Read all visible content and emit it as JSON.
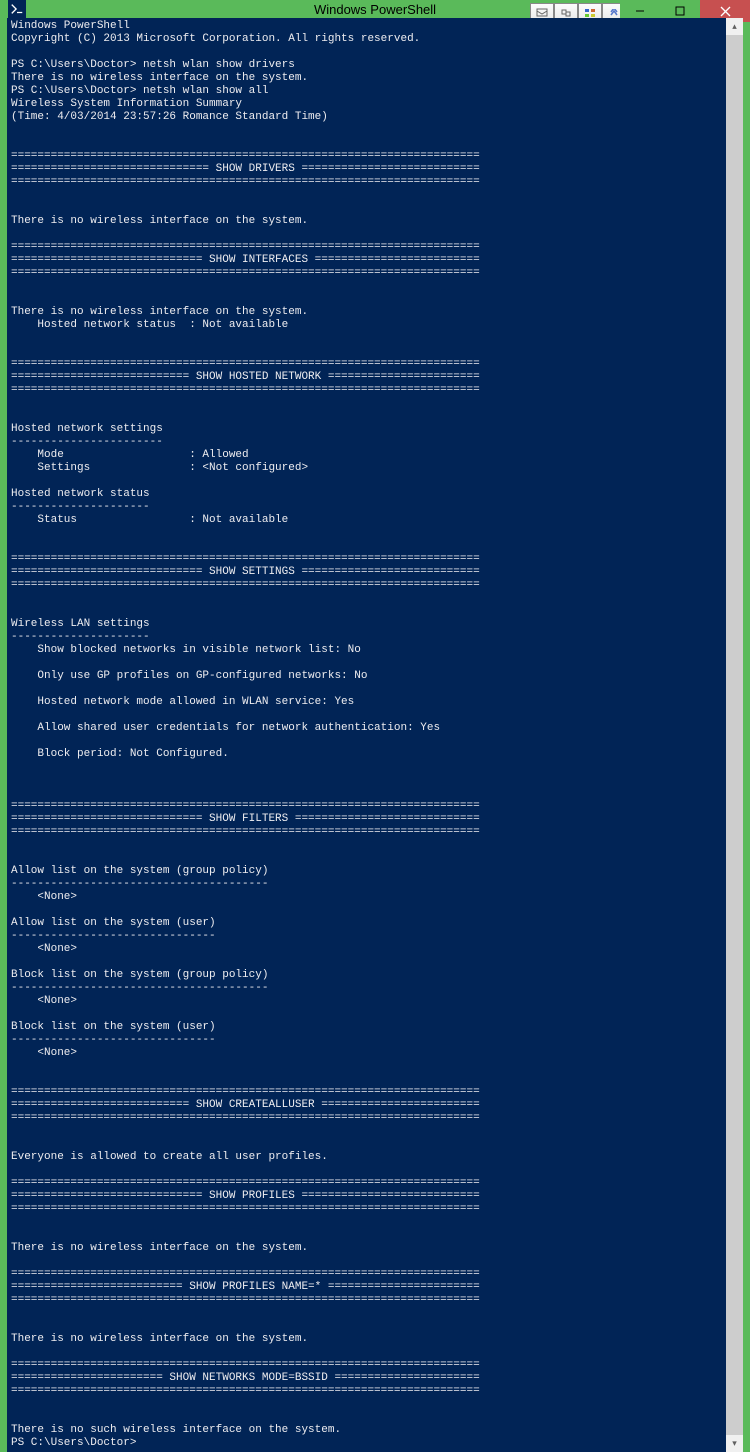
{
  "title": "Windows PowerShell",
  "lines": [
    "Windows PowerShell",
    "Copyright (C) 2013 Microsoft Corporation. All rights reserved.",
    "",
    "PS C:\\Users\\Doctor> netsh wlan show drivers",
    "There is no wireless interface on the system.",
    "PS C:\\Users\\Doctor> netsh wlan show all",
    "Wireless System Information Summary",
    "(Time: 4/03/2014 23:57:26 Romance Standard Time)",
    "",
    "",
    "=======================================================================",
    "============================== SHOW DRIVERS ===========================",
    "=======================================================================",
    "",
    "",
    "There is no wireless interface on the system.",
    "",
    "=======================================================================",
    "============================= SHOW INTERFACES =========================",
    "=======================================================================",
    "",
    "",
    "There is no wireless interface on the system.",
    "    Hosted network status  : Not available",
    "",
    "",
    "=======================================================================",
    "=========================== SHOW HOSTED NETWORK =======================",
    "=======================================================================",
    "",
    "",
    "Hosted network settings",
    "-----------------------",
    "    Mode                   : Allowed",
    "    Settings               : <Not configured>",
    "",
    "Hosted network status",
    "---------------------",
    "    Status                 : Not available",
    "",
    "",
    "=======================================================================",
    "============================= SHOW SETTINGS ===========================",
    "=======================================================================",
    "",
    "",
    "Wireless LAN settings",
    "---------------------",
    "    Show blocked networks in visible network list: No",
    "",
    "    Only use GP profiles on GP-configured networks: No",
    "",
    "    Hosted network mode allowed in WLAN service: Yes",
    "",
    "    Allow shared user credentials for network authentication: Yes",
    "",
    "    Block period: Not Configured.",
    "",
    "",
    "",
    "=======================================================================",
    "============================= SHOW FILTERS ============================",
    "=======================================================================",
    "",
    "",
    "Allow list on the system (group policy)",
    "---------------------------------------",
    "    <None>",
    "",
    "Allow list on the system (user)",
    "-------------------------------",
    "    <None>",
    "",
    "Block list on the system (group policy)",
    "---------------------------------------",
    "    <None>",
    "",
    "Block list on the system (user)",
    "-------------------------------",
    "    <None>",
    "",
    "",
    "=======================================================================",
    "=========================== SHOW CREATEALLUSER ========================",
    "=======================================================================",
    "",
    "",
    "Everyone is allowed to create all user profiles.",
    "",
    "=======================================================================",
    "============================= SHOW PROFILES ===========================",
    "=======================================================================",
    "",
    "",
    "There is no wireless interface on the system.",
    "",
    "=======================================================================",
    "========================== SHOW PROFILES NAME=* =======================",
    "=======================================================================",
    "",
    "",
    "There is no wireless interface on the system.",
    "",
    "=======================================================================",
    "======================= SHOW NETWORKS MODE=BSSID ======================",
    "=======================================================================",
    "",
    "",
    "There is no such wireless interface on the system.",
    "PS C:\\Users\\Doctor>"
  ]
}
